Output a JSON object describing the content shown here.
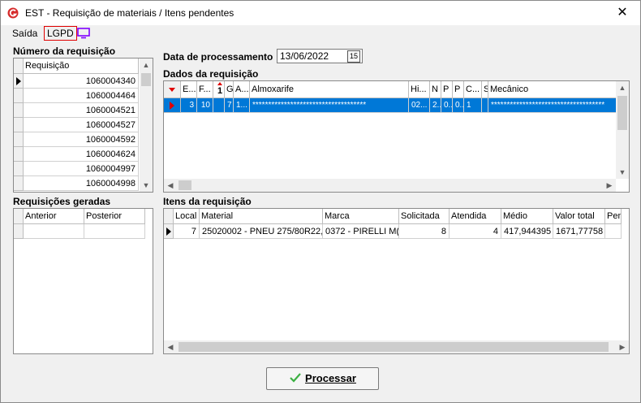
{
  "window": {
    "title": "EST - Requisição de materiais / Itens pendentes",
    "close_glyph": "✕"
  },
  "menu": {
    "items": [
      "Saída",
      "LGPD"
    ]
  },
  "numero": {
    "label": "Número da requisição",
    "header": "Requisição",
    "rows": [
      "1060004340",
      "1060004464",
      "1060004521",
      "1060004527",
      "1060004592",
      "1060004624",
      "1060004997",
      "1060004998"
    ]
  },
  "data_proc": {
    "label": "Data de processamento",
    "value": "13/06/2022",
    "button_glyph": "15"
  },
  "dados": {
    "label": "Dados da requisição",
    "headers": [
      "E...",
      "F...",
      "",
      "G",
      "A...",
      "Almoxarife",
      "Hi...",
      "N",
      "P",
      "P",
      "C...",
      "S",
      "Mecânico"
    ],
    "row": [
      "3",
      "10",
      "7",
      "1...",
      "************************************",
      "02...",
      "2...",
      "0...",
      "0...",
      "1",
      "",
      "************************************"
    ]
  },
  "geradas": {
    "label": "Requisições geradas",
    "headers": [
      "Anterior",
      "Posterior"
    ]
  },
  "itens": {
    "label": "Itens da requisição",
    "headers": [
      "Local",
      "Material",
      "Marca",
      "Solicitada",
      "Atendida",
      "Médio",
      "Valor total",
      "Pen"
    ],
    "row": [
      "7",
      "25020002 - PNEU 275/80R22,",
      "0372 - PIRELLI M(",
      "8",
      "4",
      "417,944395",
      "1671,77758",
      ""
    ]
  },
  "process_button": {
    "label": "Processar",
    "icon": "check-icon"
  },
  "colors": {
    "selection": "#0078d7",
    "accent_red": "#e00000",
    "check_green": "#3cb043",
    "lgpd_icon": "#8000ff"
  }
}
